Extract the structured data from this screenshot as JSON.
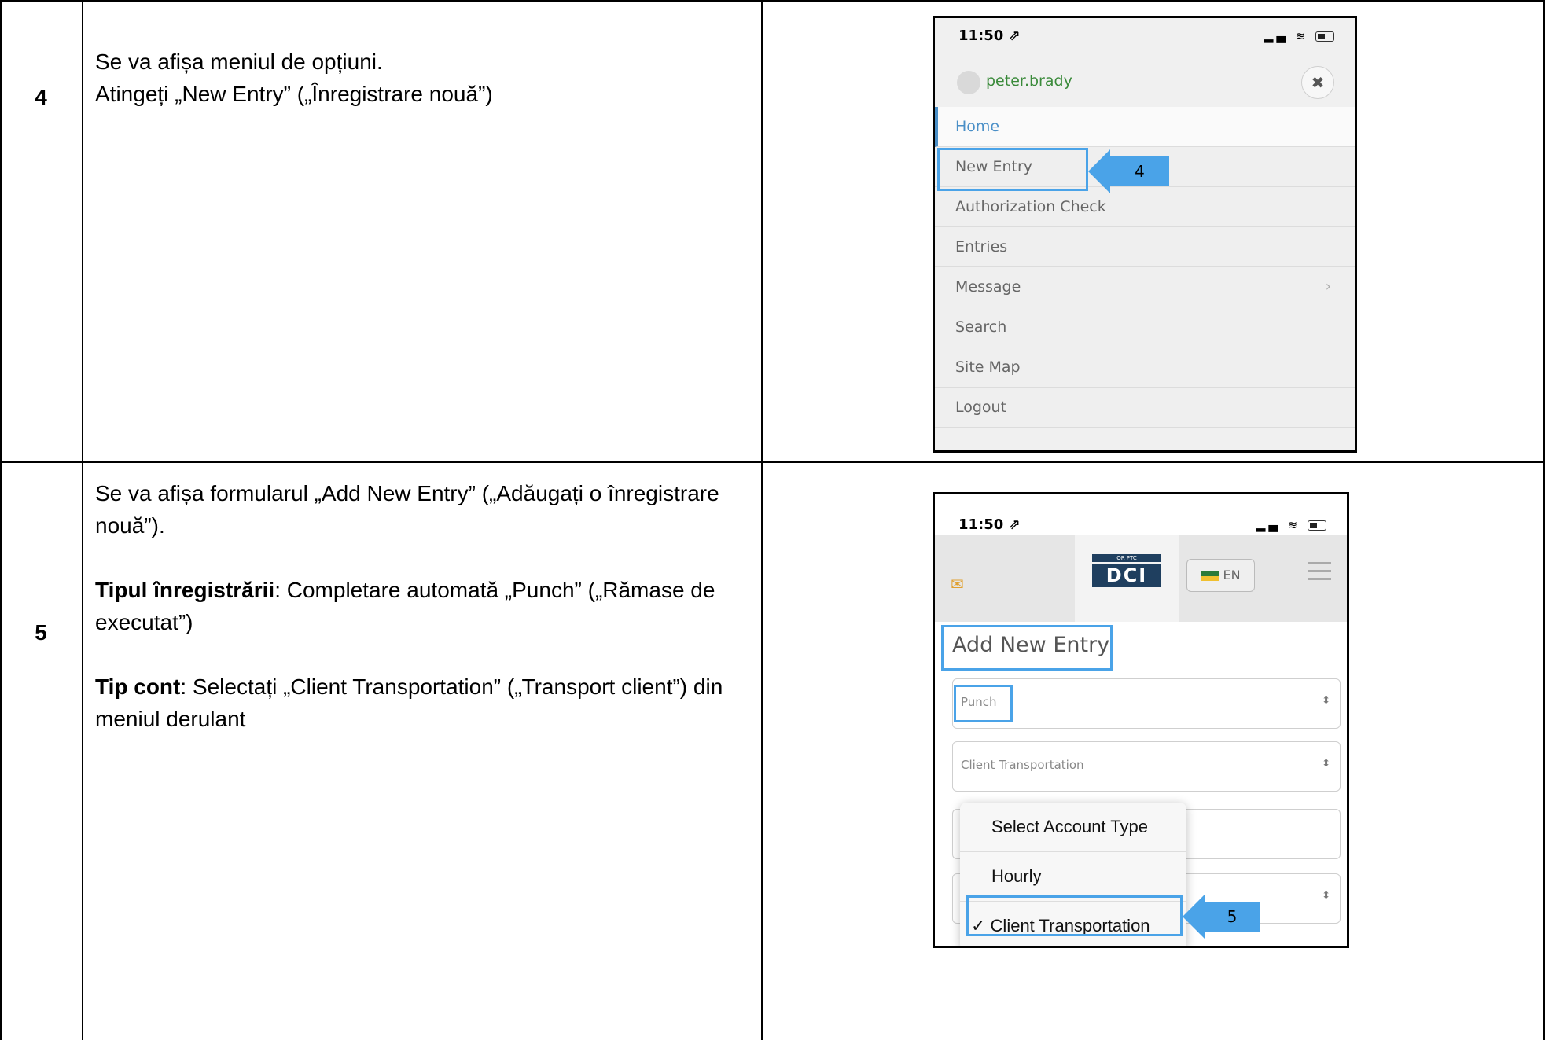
{
  "rows": [
    {
      "step": "4",
      "instructions": [
        "Se va afișa meniul de opțiuni.",
        "Atingeți „New Entry” („Înregistrare nouă”)"
      ]
    },
    {
      "step": "5",
      "instructions": [
        "Se va afișa formularul „Add New Entry” („Adăugați o înregistrare nouă”).",
        "Completare automată „Punch” („Rămase de executat”)",
        "Selectați „Client Transportation” („Transport client”) din meniul derulant"
      ],
      "labels": {
        "entry_type": "Tipul înregistrării",
        "account_type": "Tip cont"
      }
    }
  ],
  "screen1": {
    "time": "11:50 ⇗",
    "username": "peter.brady",
    "close_icon": "✖",
    "menu": [
      "Home",
      "New Entry",
      "Authorization Check",
      "Entries",
      "Message",
      "Search",
      "Site Map",
      "Logout"
    ],
    "message_chevron": "›",
    "callout": "4"
  },
  "screen2": {
    "time": "11:50 ⇗",
    "logo_top": "OR PTC",
    "logo_mark": "DCI",
    "lang": "EN",
    "page_title": "Add New Entry",
    "entry_type_value": "Punch",
    "account_type_value": "Client Transportation",
    "dropdown_options": [
      "Select Account Type",
      "Hourly",
      "✓ Client Transportation"
    ],
    "callout": "5"
  },
  "colors": {
    "highlight": "#4aa3e8",
    "username": "#3a8a3a",
    "home": "#4a8fc7"
  }
}
